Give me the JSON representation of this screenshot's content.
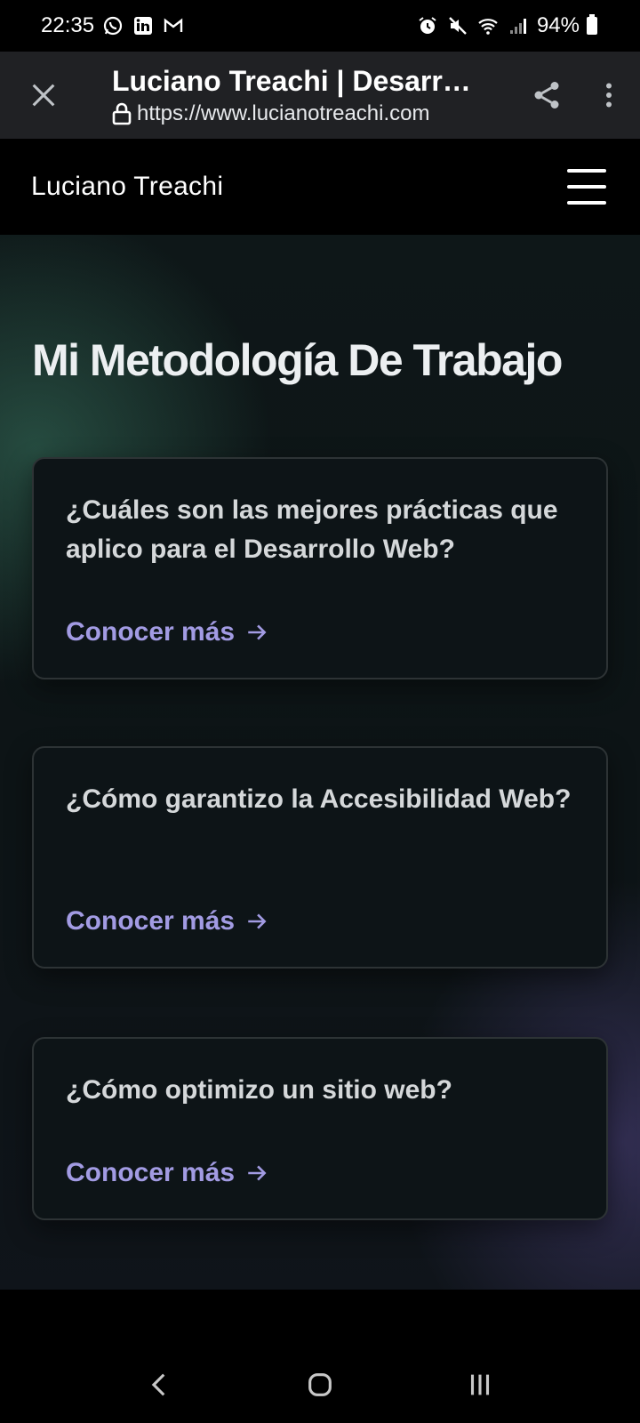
{
  "status_bar": {
    "time": "22:35",
    "battery": "94%",
    "left_icons": [
      "whatsapp-icon",
      "linkedin-icon",
      "gmail-icon"
    ],
    "right_icons": [
      "alarm-icon",
      "mute-icon",
      "wifi-icon",
      "signal-icon",
      "battery-icon"
    ]
  },
  "browser": {
    "title": "Luciano Treachi | Desarrollador Web",
    "url": "https://www.lucianotreachi.com"
  },
  "site": {
    "brand": "Luciano Treachi"
  },
  "section": {
    "title": "Mi Metodología De Trabajo",
    "cards": [
      {
        "question": "¿Cuáles son las mejores prácticas que aplico para el Desarrollo Web?",
        "link": "Conocer más"
      },
      {
        "question": "¿Cómo garantizo la Accesibilidad Web?",
        "link": "Conocer más"
      },
      {
        "question": "¿Cómo optimizo un sitio web?",
        "link": "Conocer más"
      }
    ]
  },
  "colors": {
    "accent_link": "#a29be3",
    "card_bg": "#0d1417",
    "toolbar_bg": "#202124"
  }
}
